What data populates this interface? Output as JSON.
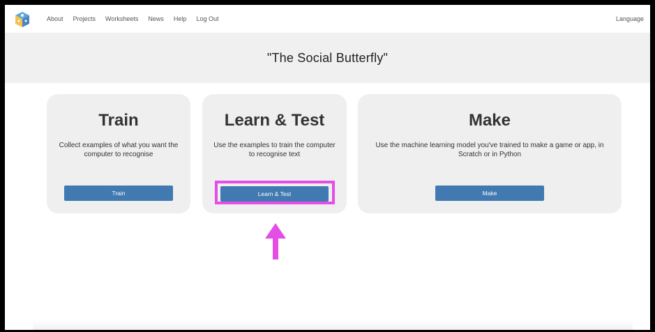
{
  "nav": {
    "links": [
      "About",
      "Projects",
      "Worksheets",
      "News",
      "Help",
      "Log Out"
    ],
    "language": "Language"
  },
  "banner": {
    "title": "\"The Social Butterfly\""
  },
  "cards": {
    "train": {
      "title": "Train",
      "description": "Collect examples of what you want the computer to recognise",
      "button": "Train"
    },
    "learn": {
      "title": "Learn & Test",
      "description": "Use the examples to train the computer to recognise text",
      "button": "Learn & Test"
    },
    "make": {
      "title": "Make",
      "description": "Use the machine learning model you've trained to make a game or app, in Scratch or in Python",
      "button": "Make"
    }
  },
  "icons": {
    "logo": "ml-cube-logo-icon",
    "annotation": "up-arrow-icon"
  },
  "colors": {
    "button": "#4179b1",
    "highlight": "#e44ee6",
    "banner": "#f0f0f0",
    "card": "#efefef"
  }
}
